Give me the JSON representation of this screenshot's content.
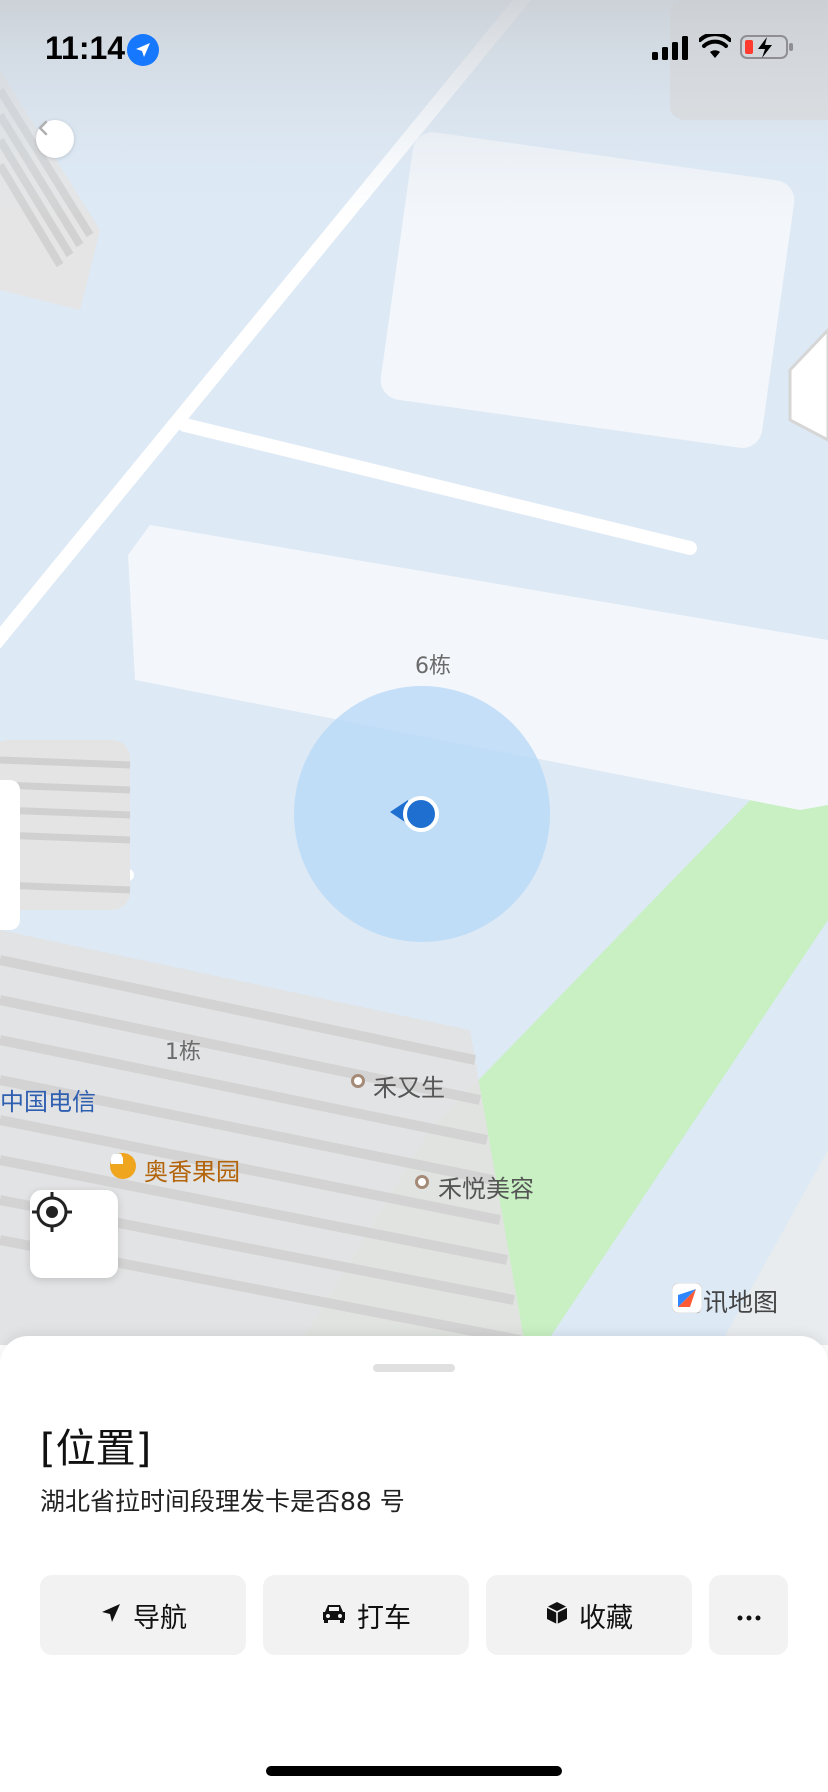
{
  "status_bar": {
    "time": "11:14",
    "icons": [
      "location-arrow-icon",
      "cellular-signal-icon",
      "wifi-icon",
      "battery-low-charging-icon"
    ]
  },
  "map": {
    "labels": {
      "building_6": "6栋",
      "building_1": "1栋",
      "china_telecom": "中国电信",
      "fruit_shop": "奥香果园",
      "poi_1": "禾又生",
      "poi_2": "禾悦美容"
    },
    "brand": "腾讯地图",
    "colors": {
      "water_bg": "#dde9f5",
      "park": "#c8f0c3",
      "building": "#f3f6fa",
      "accuracy_circle": "#b9d9f8",
      "location_dot": "#1f6fd1",
      "poi_orange": "#f0a51e",
      "poi_text_orange": "#b3630a",
      "poi_text_blue": "#2f5fb0"
    }
  },
  "sheet": {
    "title": "[位置]",
    "address": "湖北省拉时间段理发卡是否88 号",
    "actions": [
      {
        "label": "导航",
        "icon": "navigation-arrow-icon"
      },
      {
        "label": "打车",
        "icon": "car-icon"
      },
      {
        "label": "收藏",
        "icon": "cube-icon"
      },
      {
        "label": "",
        "icon": "more-icon"
      }
    ]
  }
}
